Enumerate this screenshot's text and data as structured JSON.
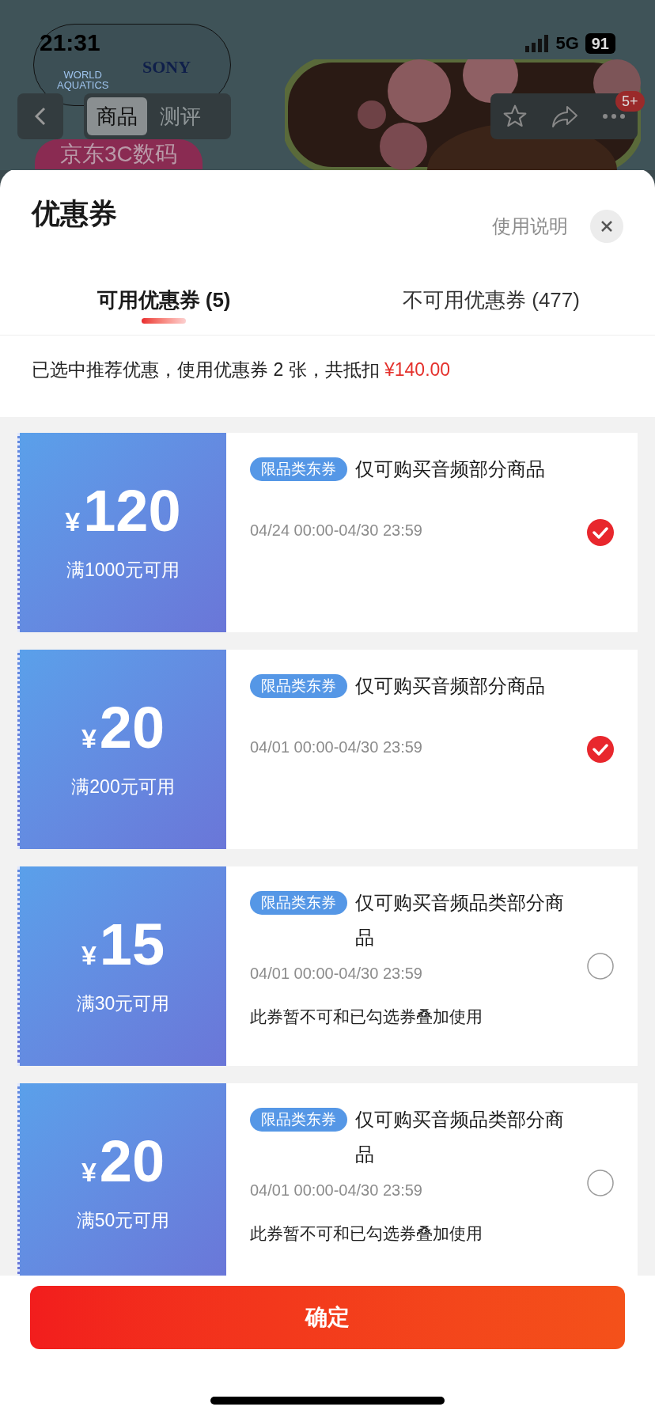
{
  "status_bar": {
    "time": "21:31",
    "network": "5G",
    "battery": "91"
  },
  "background_page": {
    "logo": {
      "left_lines": [
        "WORLD",
        "AQUATICS"
      ],
      "right": "SONY"
    },
    "tabs": [
      {
        "label": "商品",
        "selected": true
      },
      {
        "label": "测评",
        "selected": false
      }
    ],
    "badge": "5+",
    "banner": "京东3C数码"
  },
  "sheet": {
    "title": "优惠券",
    "help_link": "使用说明",
    "tabs": [
      {
        "label": "可用优惠券 (5)",
        "selected": true
      },
      {
        "label": "不可用优惠券 (477)",
        "selected": false
      }
    ],
    "summary": {
      "text": "已选中推荐优惠，使用优惠券 2 张，共抵扣",
      "amount": "¥140.00"
    },
    "coupons": [
      {
        "currency": "¥",
        "amount": "120",
        "condition": "满1000元可用",
        "tag": "限品类东券",
        "title": "仅可购买音频部分商品",
        "validity": "04/24 00:00-04/30 23:59",
        "selected": true
      },
      {
        "currency": "¥",
        "amount": "20",
        "condition": "满200元可用",
        "tag": "限品类东券",
        "title": "仅可购买音频部分商品",
        "validity": "04/01 00:00-04/30 23:59",
        "selected": true
      },
      {
        "currency": "¥",
        "amount": "15",
        "condition": "满30元可用",
        "tag": "限品类东券",
        "title": "仅可购买音频品类部分商品",
        "validity": "04/01 00:00-04/30 23:59",
        "note": "此券暂不可和已勾选券叠加使用",
        "selected": false
      },
      {
        "currency": "¥",
        "amount": "20",
        "condition": "满50元可用",
        "tag": "限品类东券",
        "title": "仅可购买音频品类部分商品",
        "validity": "04/01 00:00-04/30 23:59",
        "note": "此券暂不可和已勾选券叠加使用",
        "selected": false
      }
    ],
    "confirm_button": "确定"
  }
}
